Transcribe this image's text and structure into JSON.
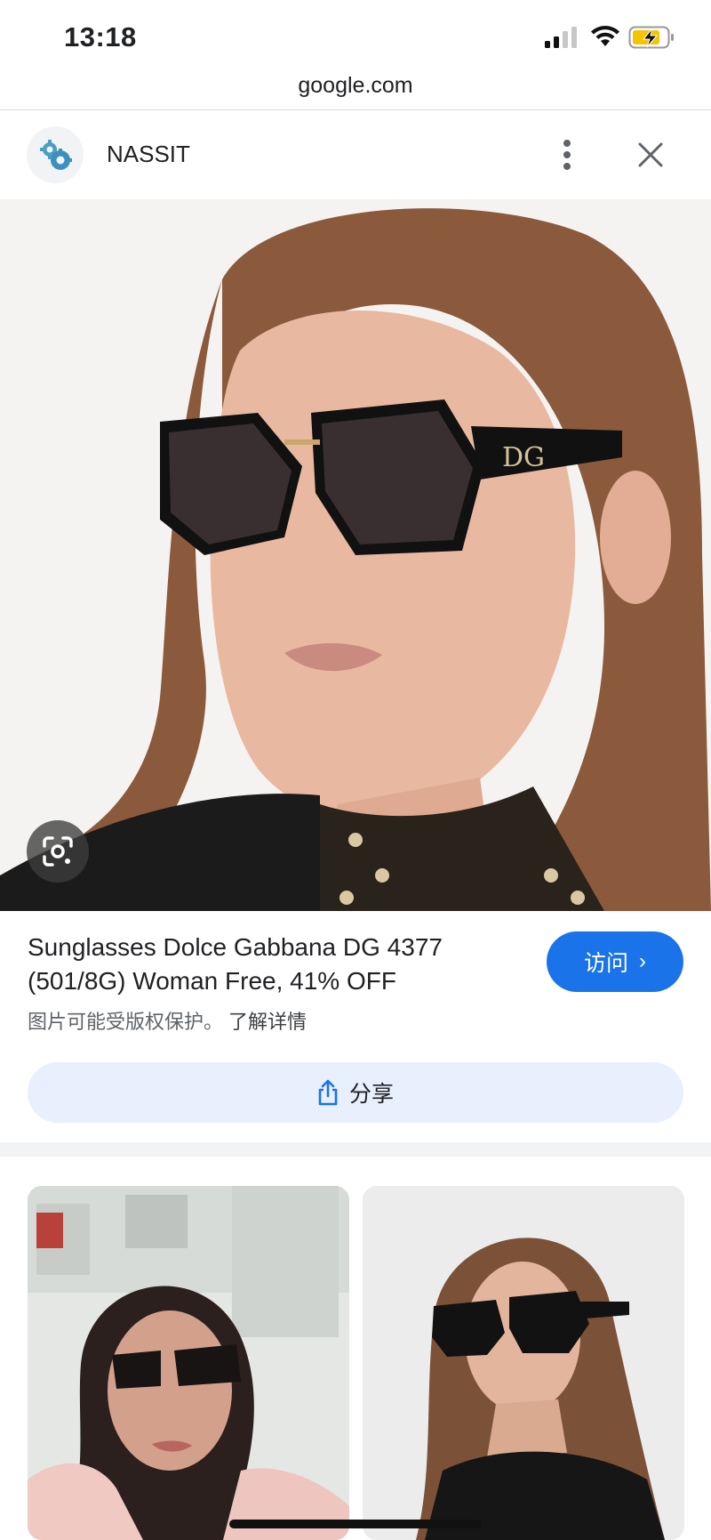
{
  "status_bar": {
    "time": "13:18",
    "icons": [
      "signal-icon",
      "wifi-icon",
      "battery-charging-icon"
    ]
  },
  "browser": {
    "url": "google.com"
  },
  "source": {
    "name": "NASSIT",
    "logo_icon": "gears-icon"
  },
  "result": {
    "title_line1": "Sunglasses Dolce Gabbana DG 4377",
    "title_line2": "(501/8G) Woman Free, 41% OFF",
    "copyright_notice": "图片可能受版权保护。",
    "learn_more": "了解详情",
    "visit_label": "访问",
    "share_label": "分享"
  },
  "colors": {
    "accent": "#1a73e8",
    "share_bg": "#e8f0fe"
  }
}
